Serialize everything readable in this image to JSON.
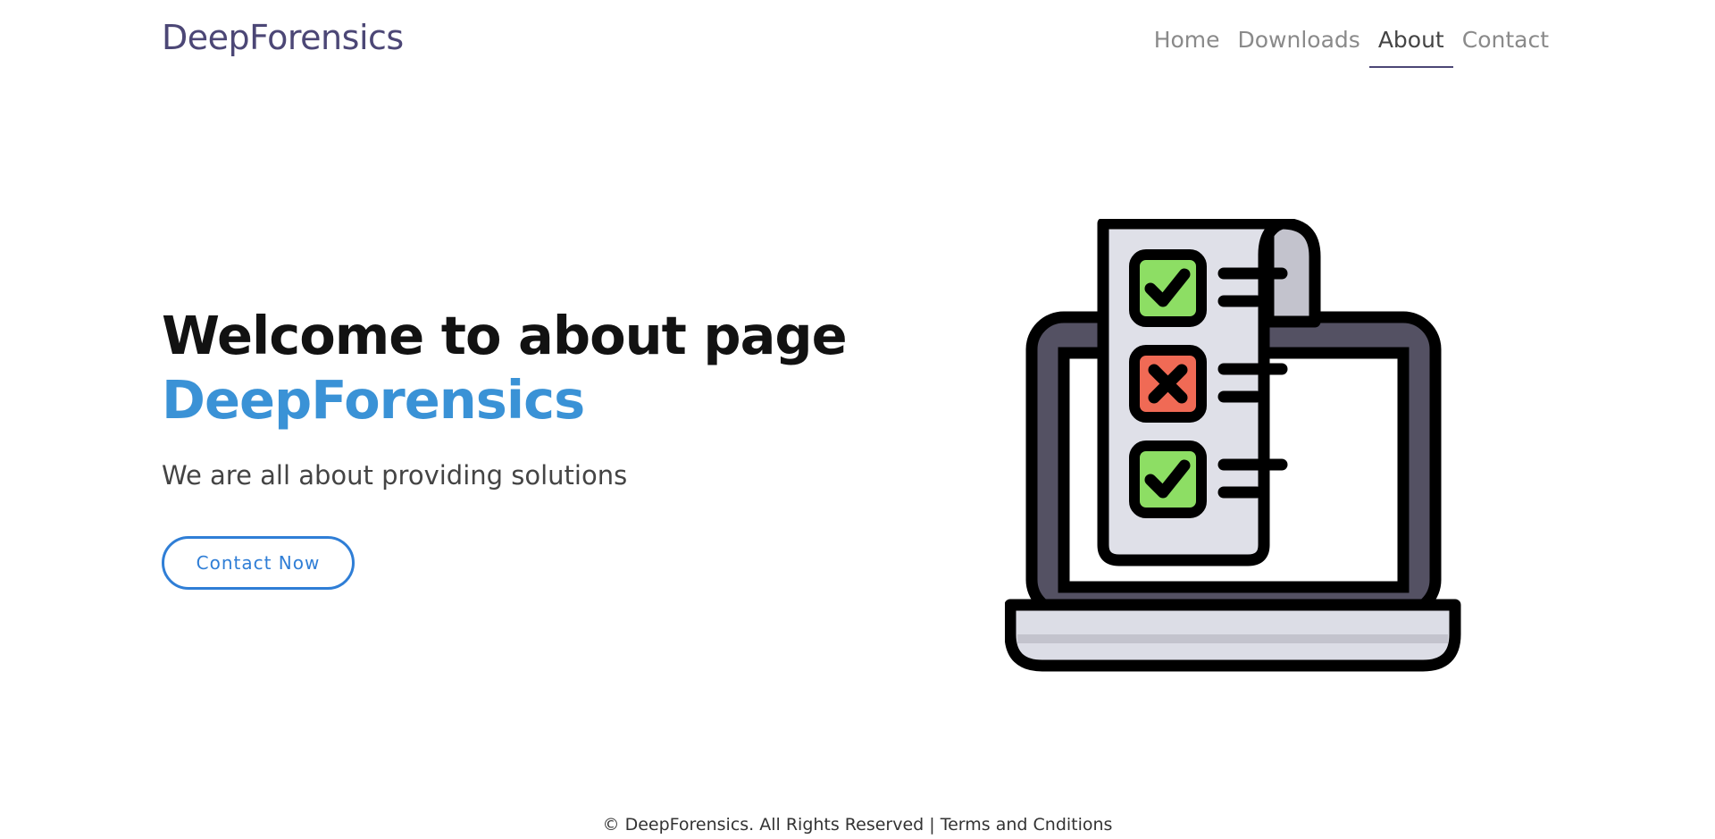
{
  "nav": {
    "brand": "DeepForensics",
    "items": [
      {
        "label": "Home",
        "active": false
      },
      {
        "label": "Downloads",
        "active": false
      },
      {
        "label": "About",
        "active": true
      },
      {
        "label": "Contact",
        "active": false
      }
    ]
  },
  "hero": {
    "title": "Welcome to about page",
    "brand": "DeepForensics",
    "subtitle": "We are all about providing solutions",
    "cta_label": "Contact Now"
  },
  "illustration": {
    "icon": "laptop-checklist-icon",
    "colors": {
      "outline": "#000000",
      "laptop_body": "#545163",
      "screen": "#ffffff",
      "paper": "#dfe0e8",
      "paper_fold": "#c3c3cd",
      "check_green": "#8dde64",
      "cross_red": "#f06a55",
      "base": "#dcdde6"
    }
  },
  "footer": {
    "copyright": "© DeepForensics. All Rights Reserved |",
    "terms_link": "Terms and Cnditions"
  },
  "colors": {
    "brand": "#4c4776",
    "accent": "#3a92d6",
    "button": "#2f7ed6"
  }
}
